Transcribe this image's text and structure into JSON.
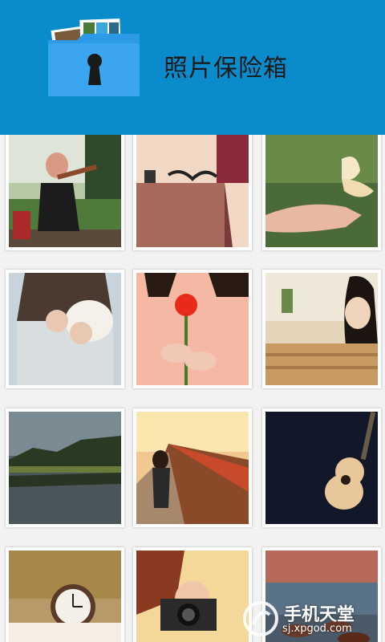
{
  "header": {
    "title": "照片保险箱",
    "icon": "folder-lock-icon",
    "color": "#0a8ccc"
  },
  "photos": [
    {
      "name": "girl-playing-violin"
    },
    {
      "name": "sunglasses-on-wood"
    },
    {
      "name": "butterfly-on-hand"
    },
    {
      "name": "girl-holding-cup"
    },
    {
      "name": "girl-holding-red-flower"
    },
    {
      "name": "girl-leaning-on-railing"
    },
    {
      "name": "lake-and-forest"
    },
    {
      "name": "girl-on-train-platform"
    },
    {
      "name": "guitar-on-dark-background"
    },
    {
      "name": "alarm-clock"
    },
    {
      "name": "girl-with-camera"
    },
    {
      "name": "rocky-seashore-sunset"
    }
  ],
  "watermark": {
    "main": "手机天堂",
    "sub": "sj.xpgod.com"
  }
}
